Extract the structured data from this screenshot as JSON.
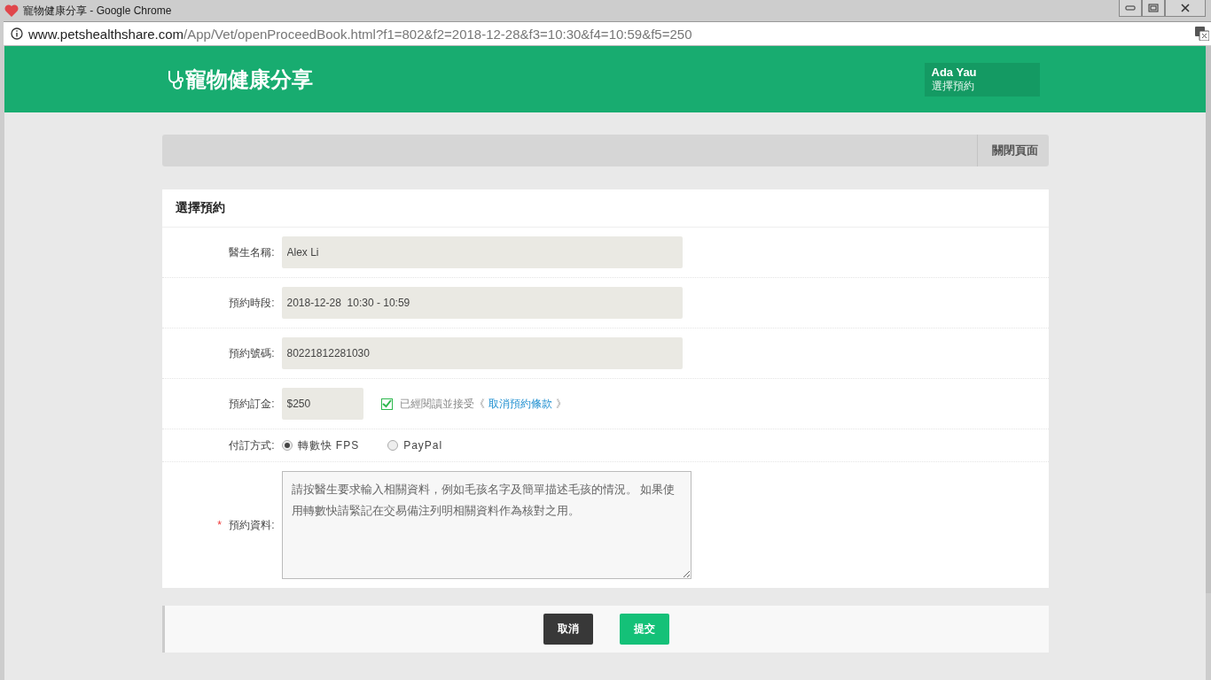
{
  "window": {
    "title": "寵物健康分享 - Google Chrome"
  },
  "address_bar": {
    "host": "www.petshealthshare.com",
    "path": "/App/Vet/openProceedBook.html?f1=802&f2=2018-12-28&f3=10:30&f4=10:59&f5=250"
  },
  "header": {
    "logo": "寵物健康分享",
    "user": {
      "name": "Ada Yau",
      "page": "選擇預約"
    }
  },
  "toolbar": {
    "close_button": "關閉頁面"
  },
  "form": {
    "title": "選擇預約",
    "fields": [
      {
        "kind": "input",
        "label": "醫生名稱:",
        "value": "Alex Li"
      },
      {
        "kind": "input",
        "label": "預約時段:",
        "value": "2018-12-28  10:30 - 10:59"
      },
      {
        "kind": "input",
        "label": "預約號碼:",
        "value": "80221812281030"
      },
      {
        "kind": "deposit",
        "label": "預約訂金:",
        "value": "$250",
        "agreement": {
          "checked": true,
          "text": "已經閱讀並接受《",
          "link": "取消預約條款",
          "suffix": "》"
        }
      },
      {
        "kind": "radio",
        "label": "付訂方式:",
        "options": [
          {
            "label": "轉數快 FPS",
            "selected": true
          },
          {
            "label": "PayPal",
            "selected": false
          }
        ]
      },
      {
        "kind": "textarea",
        "label": "預約資料:",
        "required_mark": "*",
        "value": "請按醫生要求輸入相關資料，例如毛孩名字及簡單描述毛孩的情況。 如果使用轉數快請緊記在交易備注列明相關資料作為核對之用。"
      }
    ]
  },
  "buttons": [
    {
      "kind": "cancel",
      "label": "取消"
    },
    {
      "kind": "submit",
      "label": "提交"
    }
  ]
}
